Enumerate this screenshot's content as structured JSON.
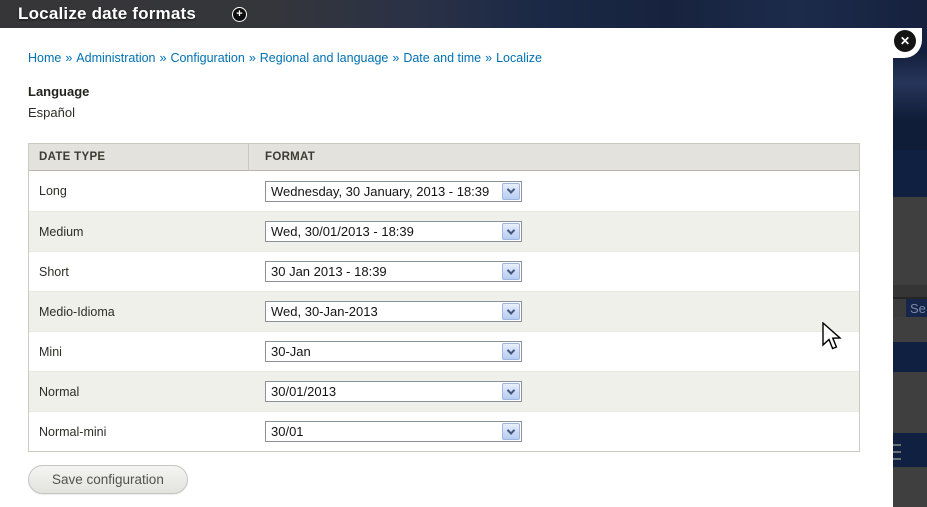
{
  "overlay": {
    "title": "Localize date formats",
    "plus_icon_glyph": "+",
    "close_icon_glyph": "✕"
  },
  "breadcrumb": {
    "separator": "»",
    "items": [
      "Home",
      "Administration",
      "Configuration",
      "Regional and language",
      "Date and time",
      "Localize"
    ]
  },
  "language": {
    "label": "Language",
    "value": "Español"
  },
  "table": {
    "columns": [
      "DATE TYPE",
      "FORMAT"
    ],
    "rows": [
      {
        "date_type": "Long",
        "format": "Wednesday, 30 January, 2013 - 18:39"
      },
      {
        "date_type": "Medium",
        "format": "Wed, 30/01/2013 - 18:39"
      },
      {
        "date_type": "Short",
        "format": "30 Jan 2013 - 18:39"
      },
      {
        "date_type": "Medio-Idioma",
        "format": "Wed, 30-Jan-2013"
      },
      {
        "date_type": "Mini",
        "format": "30-Jan"
      },
      {
        "date_type": "Normal",
        "format": "30/01/2013"
      },
      {
        "date_type": "Normal-mini",
        "format": "30/01"
      }
    ]
  },
  "actions": {
    "save_label": "Save configuration"
  },
  "background_page": {
    "search_button_text": "Se"
  },
  "colors": {
    "link_blue": "#0071b3",
    "titlebar_navy": "#17233e",
    "backdrop_navy": "#0f2040",
    "backdrop_gray": "#3f3f40",
    "table_header_bg": "#e3e2dc",
    "row_stripe_bg": "#f0f0ea",
    "select_button_blue": "#cbdaf5"
  }
}
